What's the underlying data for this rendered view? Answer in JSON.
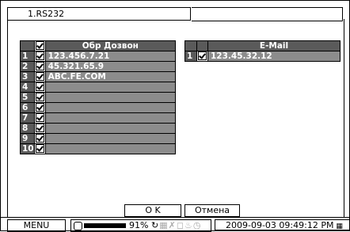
{
  "tab": {
    "label": "1.RS232"
  },
  "callback_table": {
    "header": "Обр Дозвон",
    "header_checked": true,
    "rows": [
      {
        "num": "1",
        "checked": true,
        "value": "123.456.7.21"
      },
      {
        "num": "2",
        "checked": true,
        "value": "45.321.65.9"
      },
      {
        "num": "3",
        "checked": true,
        "value": "ABC.FE.COM"
      },
      {
        "num": "4",
        "checked": true,
        "value": ""
      },
      {
        "num": "5",
        "checked": true,
        "value": ""
      },
      {
        "num": "6",
        "checked": true,
        "value": ""
      },
      {
        "num": "7",
        "checked": true,
        "value": ""
      },
      {
        "num": "8",
        "checked": true,
        "value": ""
      },
      {
        "num": "9",
        "checked": true,
        "value": ""
      },
      {
        "num": "10",
        "checked": true,
        "value": ""
      }
    ]
  },
  "email_table": {
    "header": "E-Mail",
    "rows": [
      {
        "num": "1",
        "checked": true,
        "value": "123.45.32.12"
      }
    ]
  },
  "buttons": {
    "ok": "O K",
    "cancel": "Отмена"
  },
  "status": {
    "menu": "MENU",
    "hdd_percent": "91%",
    "hdd_usage_fraction": 0.91,
    "datetime": "2009-09-03 09:49:12 PM",
    "icons": [
      "hdd-icon",
      "refresh-icon",
      "network-icon",
      "lock-icon",
      "record-icon",
      "alarm-icon",
      "clock-icon"
    ]
  }
}
